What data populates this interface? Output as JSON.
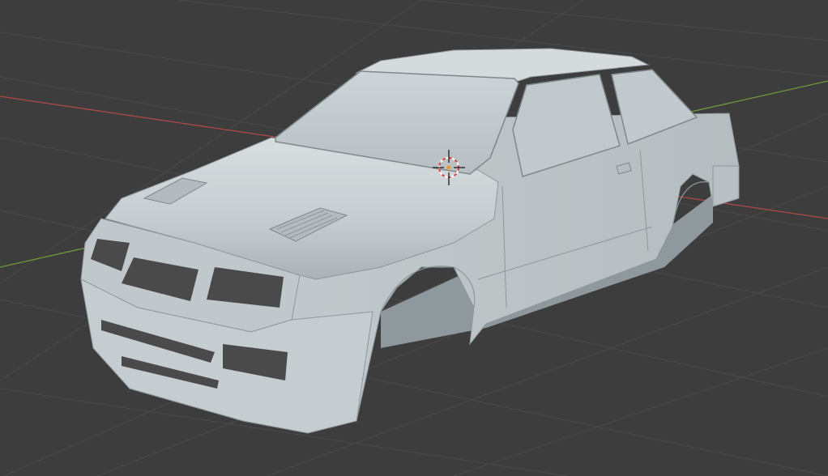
{
  "viewport": {
    "background_color": "#3d3d3d",
    "grid_color": "#4a4a4a",
    "x_axis_color": "#b04848",
    "y_axis_color": "#6f9a3a",
    "model_color": "#c9d0d3",
    "model_shadow_color": "#9aa3a7",
    "model_highlight_color": "#dde3e5",
    "opening_color": "#4a4a4a"
  },
  "scene": {
    "object_icon": "car-body-mesh",
    "cursor_icon": "3d-cursor-icon"
  }
}
